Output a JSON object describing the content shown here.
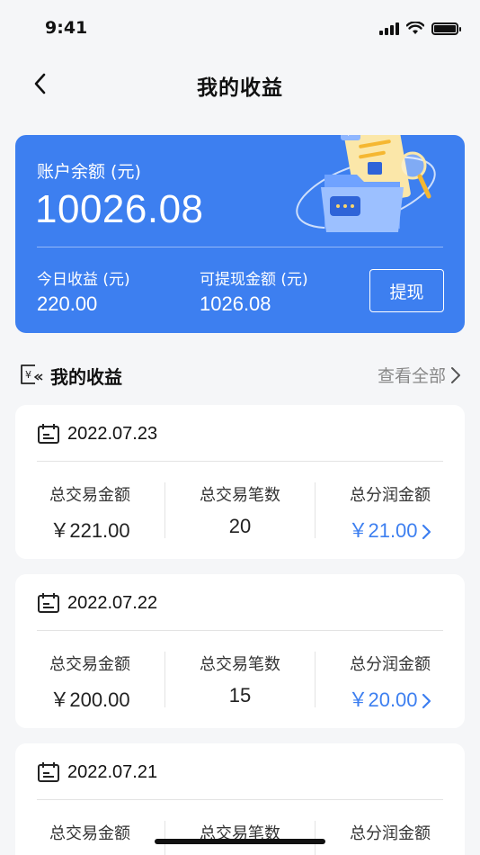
{
  "status_bar": {
    "time": "9:41"
  },
  "nav": {
    "title": "我的收益"
  },
  "balance": {
    "label": "账户余额 (元)",
    "amount": "10026.08",
    "today_label": "今日收益 (元)",
    "today_value": "220.00",
    "available_label": "可提现金额 (元)",
    "available_value": "1026.08",
    "withdraw_label": "提现"
  },
  "section": {
    "title": "我的收益",
    "view_all": "查看全部"
  },
  "records": [
    {
      "date": "2022.07.23",
      "total_amount_label": "总交易金额",
      "total_amount": "￥221.00",
      "count_label": "总交易笔数",
      "count": "20",
      "profit_label": "总分润金额",
      "profit": "￥21.00"
    },
    {
      "date": "2022.07.22",
      "total_amount_label": "总交易金额",
      "total_amount": "￥200.00",
      "count_label": "总交易笔数",
      "count": "15",
      "profit_label": "总分润金额",
      "profit": "￥20.00"
    },
    {
      "date": "2022.07.21",
      "total_amount_label": "总交易金额",
      "total_amount": "",
      "count_label": "总交易笔数",
      "count": "",
      "profit_label": "总分润金额",
      "profit": ""
    }
  ],
  "colors": {
    "accent": "#3d7ff0",
    "background": "#f5f6f8"
  }
}
